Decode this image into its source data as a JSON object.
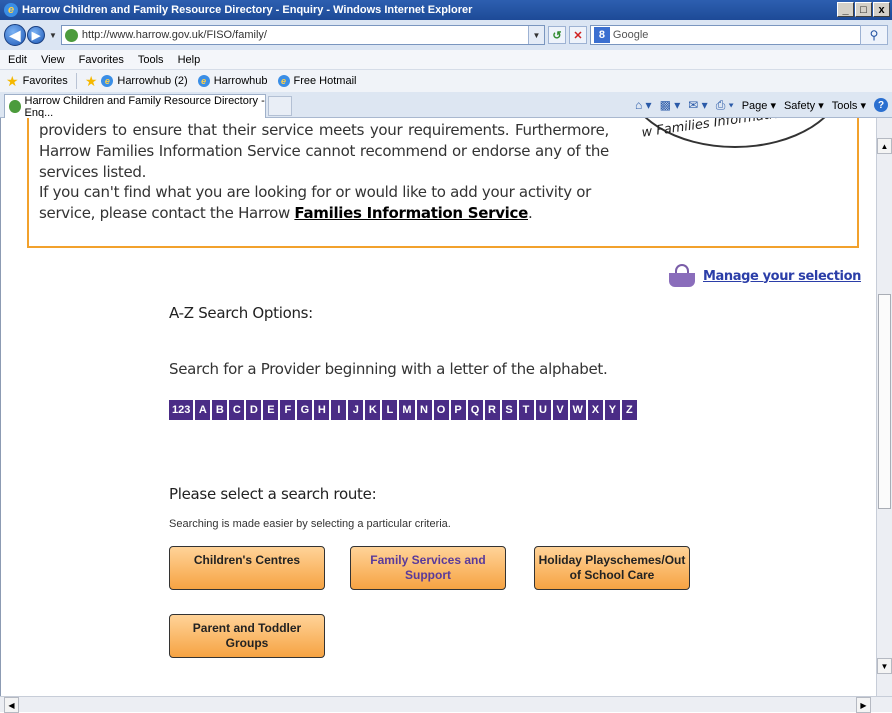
{
  "window": {
    "title": "Harrow Children and Family Resource Directory - Enquiry - Windows Internet Explorer",
    "controls": [
      "_",
      "□",
      "x"
    ]
  },
  "address": {
    "url": "http://www.harrow.gov.uk/FISO/family/",
    "search_placeholder": "Google"
  },
  "menu": [
    "Edit",
    "View",
    "Favorites",
    "Tools",
    "Help"
  ],
  "favorites": {
    "label": "Favorites",
    "items": [
      "Harrowhub (2)",
      "Harrowhub",
      "Free Hotmail"
    ]
  },
  "tab": {
    "title": "Harrow Children and Family Resource Directory - Enq..."
  },
  "command_bar": {
    "page": "Page",
    "safety": "Safety",
    "tools": "Tools"
  },
  "info": {
    "text1": "providers to ensure that their service meets your requirements. Furthermore, Harrow Families Information Service cannot recommend or endorse any of the services listed.",
    "text2_prefix": "If you can't find what you are looking for or would like to add your activity or service, please contact the Harrow ",
    "link": "Families Information Service",
    "text2_suffix": ".",
    "seal_text": "w Families Information Se"
  },
  "manage_selection": "Manage your selection",
  "az": {
    "title": "A-Z Search Options:",
    "subtitle": "Search for a Provider beginning with a letter of the alphabet.",
    "letters": [
      "123",
      "A",
      "B",
      "C",
      "D",
      "E",
      "F",
      "G",
      "H",
      "I",
      "J",
      "K",
      "L",
      "M",
      "N",
      "O",
      "P",
      "Q",
      "R",
      "S",
      "T",
      "U",
      "V",
      "W",
      "X",
      "Y",
      "Z"
    ]
  },
  "route": {
    "title": "Please select a search route:",
    "subtitle": "Searching is made easier by selecting a particular criteria.",
    "buttons": [
      "Children's Centres",
      "Family Services and Support",
      "Holiday Playschemes/Out of School Care",
      "Parent and Toddler Groups"
    ]
  },
  "colors": {
    "accent_orange": "#f2a12c",
    "letter_bg": "#4a2c86",
    "link": "#2b3ea8"
  }
}
